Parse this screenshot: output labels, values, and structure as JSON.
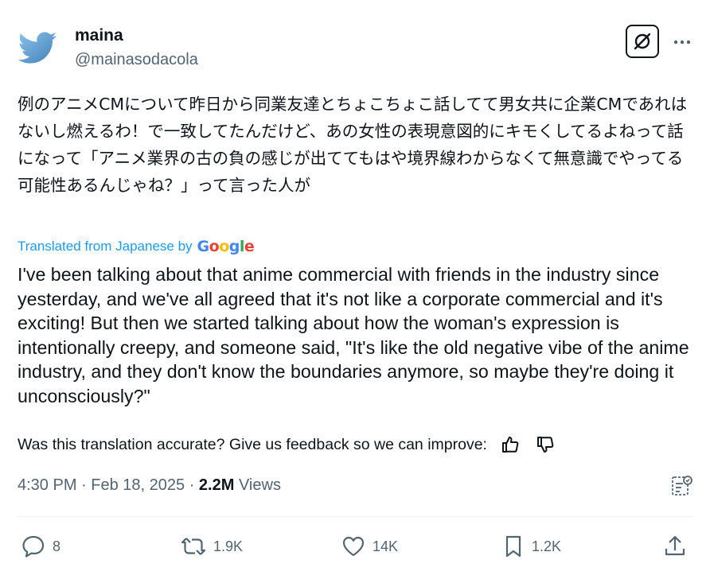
{
  "author": {
    "name": "maina",
    "handle": "@mainasodacola"
  },
  "tweet": {
    "original_text": "例のアニメCMについて昨日から同業友達とちょこちょこ話してて男女共に企業CMであれはないし燃えるわ！で一致してたんだけど、あの女性の表現意図的にキモくしてるよねって話になって「アニメ業界の古の負の感じが出ててもはや境界線わからなくて無意識でやってる可能性あるんじゃね？」って言った人が",
    "translated_from_label": "Translated from Japanese by",
    "translator_brand": "Google",
    "translated_text": "I've been talking about that anime commercial with friends in the industry since yesterday, and we've all agreed that it's not like a corporate commercial and it's exciting! But then we started talking about how the woman's expression is intentionally creepy, and someone said, \"It's like the old negative vibe of the anime industry, and they don't know the boundaries anymore, so maybe they're doing it unconsciously?\"",
    "feedback_prompt": "Was this translation accurate? Give us feedback so we can improve:",
    "time": "4:30 PM",
    "date": "Feb 18, 2025",
    "views_count": "2.2M",
    "views_label": "Views"
  },
  "actions": {
    "replies": "8",
    "reposts": "1.9K",
    "likes": "14K",
    "bookmarks": "1.2K"
  },
  "icons": {
    "avatar": "twitter-bird-avatar",
    "grok": "grok-icon",
    "more": "more-icon",
    "thumbs_up": "thumbs-up-icon",
    "thumbs_down": "thumbs-down-icon",
    "analytics": "analytics-icon",
    "reply": "reply-icon",
    "repost": "repost-icon",
    "like": "like-icon",
    "bookmark": "bookmark-icon",
    "share": "share-icon"
  },
  "colors": {
    "link": "#1d9bf0",
    "secondary_text": "#536471",
    "avatar_blue": "#5b9bd5"
  }
}
